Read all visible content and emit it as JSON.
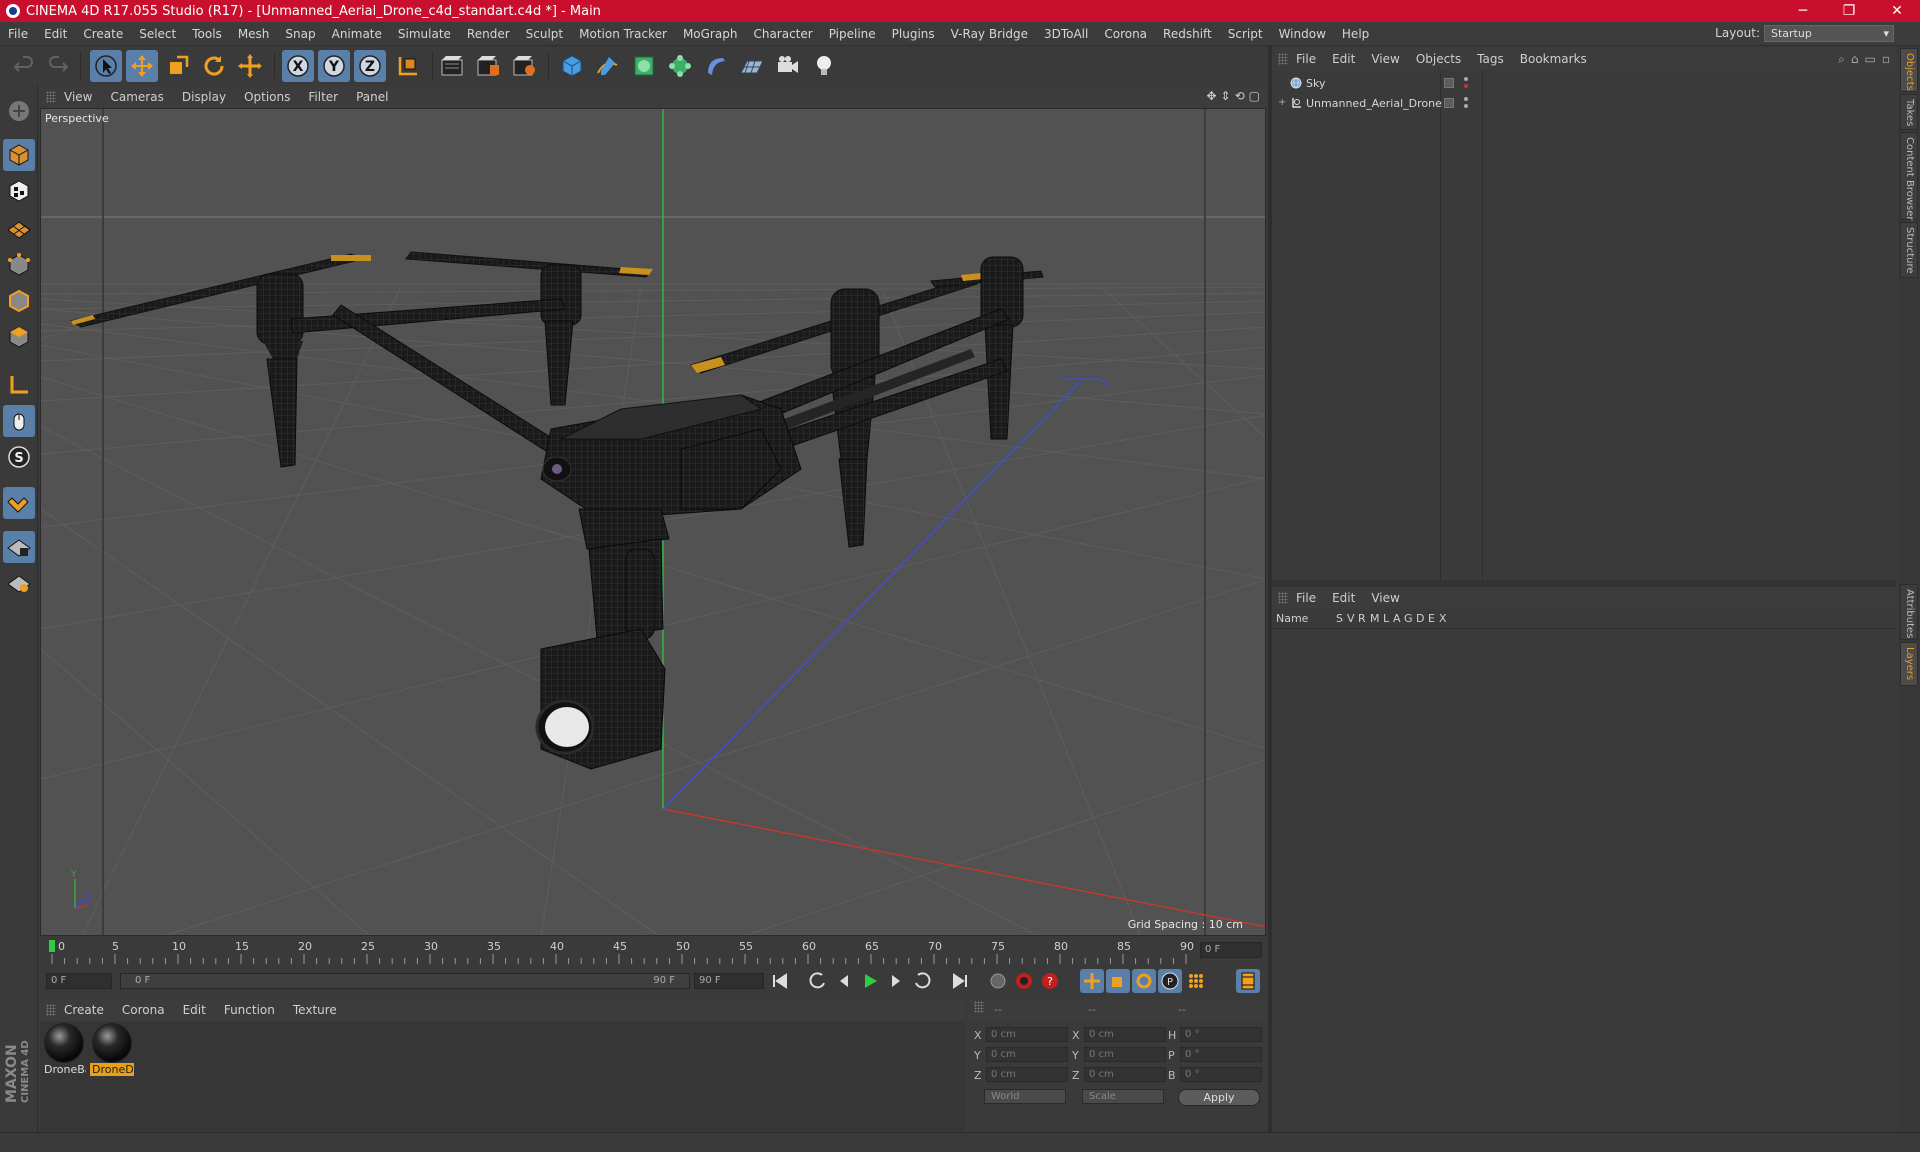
{
  "window": {
    "title": "CINEMA 4D R17.055 Studio (R17) - [Unmanned_Aerial_Drone_c4d_standart.c4d *] - Main",
    "minimize": "─",
    "maximize": "❐",
    "close": "✕"
  },
  "menu": [
    "File",
    "Edit",
    "Create",
    "Select",
    "Tools",
    "Mesh",
    "Snap",
    "Animate",
    "Simulate",
    "Render",
    "Sculpt",
    "Motion Tracker",
    "MoGraph",
    "Character",
    "Pipeline",
    "Plugins",
    "V-Ray Bridge",
    "3DToAll",
    "Corona",
    "Redshift",
    "Script",
    "Window",
    "Help"
  ],
  "layout": {
    "label": "Layout:",
    "value": "Startup"
  },
  "viewport": {
    "menu": [
      "View",
      "Cameras",
      "Display",
      "Options",
      "Filter",
      "Panel"
    ],
    "label": "Perspective",
    "grid_spacing": "Grid Spacing : 10 cm",
    "nav_icons": [
      "✥",
      "⇕",
      "⟲",
      "▢"
    ]
  },
  "timeline": {
    "ticks": [
      "0",
      "5",
      "10",
      "15",
      "20",
      "25",
      "30",
      "35",
      "40",
      "45",
      "50",
      "55",
      "60",
      "65",
      "70",
      "75",
      "80",
      "85",
      "90"
    ],
    "current_frame": "0 F",
    "start_field": "0 F",
    "range_start": "0 F",
    "range_end": "90 F",
    "end_field": "90 F"
  },
  "material_manager": {
    "menu": [
      "Create",
      "Corona",
      "Edit",
      "Function",
      "Texture"
    ],
    "materials": [
      {
        "name": "DroneBa",
        "selected": false
      },
      {
        "name": "DroneD",
        "selected": true
      }
    ]
  },
  "coordinates": {
    "header": [
      "--",
      "--",
      "--"
    ],
    "rows": [
      {
        "axis": "X",
        "pos": "0 cm",
        "size_axis": "X",
        "size": "0 cm",
        "rot_axis": "H",
        "rot": "0 °"
      },
      {
        "axis": "Y",
        "pos": "0 cm",
        "size_axis": "Y",
        "size": "0 cm",
        "rot_axis": "P",
        "rot": "0 °"
      },
      {
        "axis": "Z",
        "pos": "0 cm",
        "size_axis": "Z",
        "size": "0 cm",
        "rot_axis": "B",
        "rot": "0 °"
      }
    ],
    "space": "World",
    "mode": "Scale",
    "apply": "Apply"
  },
  "object_manager": {
    "menu": [
      "File",
      "Edit",
      "View",
      "Objects",
      "Tags",
      "Bookmarks"
    ],
    "objects": [
      {
        "name": "Sky",
        "icon": "sky-icon"
      },
      {
        "name": "Unmanned_Aerial_Drone",
        "icon": "null-object-icon"
      }
    ]
  },
  "layer_manager": {
    "menu": [
      "File",
      "Edit",
      "View"
    ],
    "columns": [
      "Name",
      "S",
      "V",
      "R",
      "M",
      "L",
      "A",
      "G",
      "D",
      "E",
      "X"
    ]
  },
  "side_tabs_top": [
    "Objects",
    "Takes",
    "Content Browser",
    "Structure"
  ],
  "side_tabs_bottom": [
    "Attributes",
    "Layers"
  ],
  "brand": {
    "maxon": "MAXON",
    "cinema": "CINEMA 4D"
  },
  "colors": {
    "title_bar": "#c8102e",
    "selection": "#5a7fa8",
    "accent": "#e8a018",
    "x_axis": "#c0392b",
    "y_axis": "#2ecc40",
    "z_axis": "#3f4fd0"
  }
}
